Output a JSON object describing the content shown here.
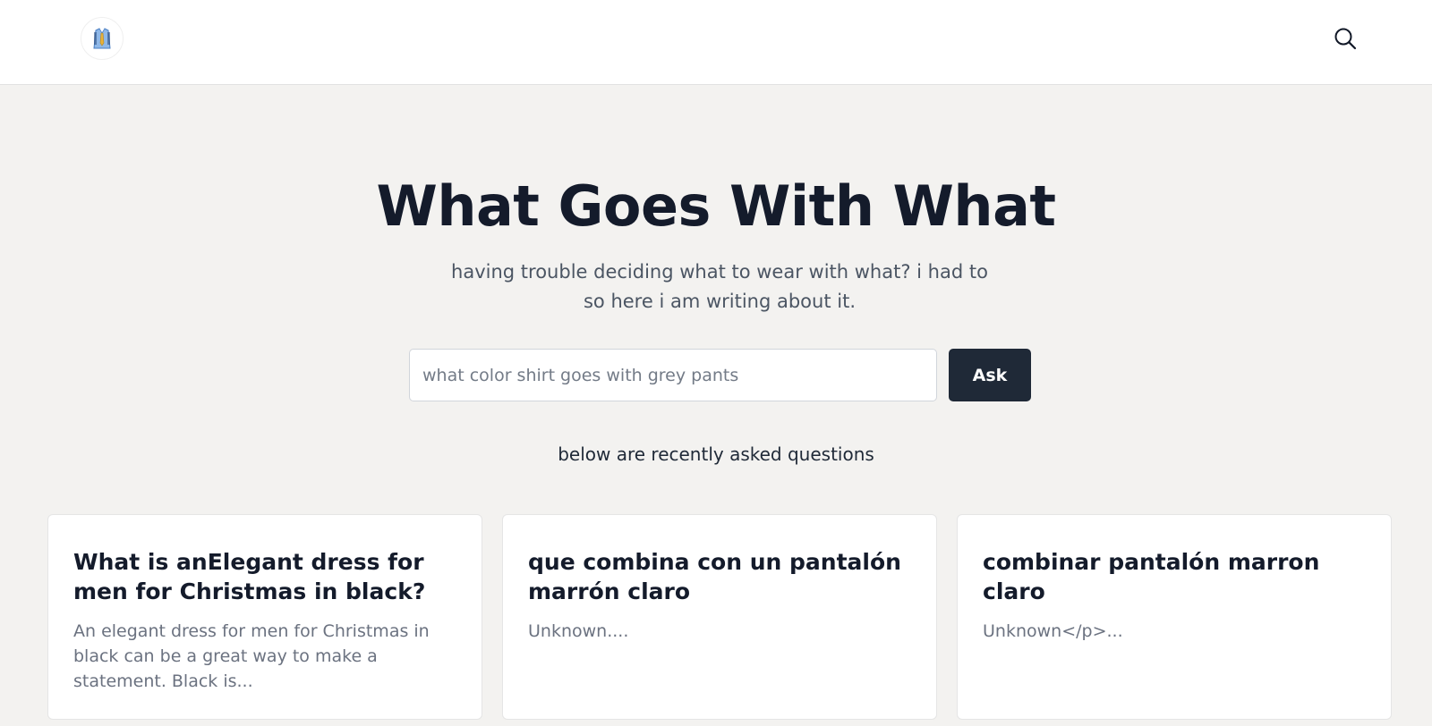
{
  "header": {
    "logo_icon": "shirt-tie-icon",
    "search_icon": "search-icon"
  },
  "hero": {
    "title": "What Goes With What",
    "subtitle": "having trouble deciding what to wear with what? i had to so here i am writing about it."
  },
  "ask": {
    "placeholder": "what color shirt goes with grey pants",
    "value": "",
    "button_label": "Ask"
  },
  "recent": {
    "label": "below are recently asked questions",
    "cards": [
      {
        "title": "What is anElegant dress for men for Christmas in black?",
        "excerpt": "An elegant dress for men for Christmas in black can be a great way to make a statement. Black is..."
      },
      {
        "title": "que combina con un pantalón marrón claro",
        "excerpt": "Unknown...."
      },
      {
        "title": "combinar pantalón marron claro",
        "excerpt": "Unknown</p>..."
      }
    ]
  },
  "colors": {
    "page_background": "#f3f2f0",
    "header_background": "#ffffff",
    "primary_button": "#1f2937",
    "title_text": "#141b2b",
    "muted_text": "#6b7280"
  }
}
